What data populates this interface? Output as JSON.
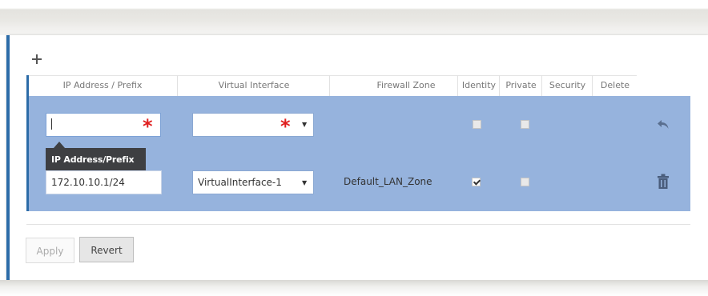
{
  "toolbar": {
    "add_icon": "plus-icon"
  },
  "table": {
    "columns": [
      "IP Address / Prefix",
      "Virtual Interface",
      "Firewall Zone",
      "Identity",
      "Private",
      "Security",
      "Delete"
    ],
    "new_row": {
      "ip_value": "",
      "virtual_interface_value": "",
      "identity_checked": false,
      "private_checked": false,
      "action_icon": "undo-icon"
    },
    "tooltip": "IP Address/Prefix",
    "rows": [
      {
        "ip": "172.10.10.1/24",
        "virtual_interface": "VirtualInterface-1",
        "firewall_zone": "Default_LAN_Zone",
        "identity_checked": true,
        "private_checked": false,
        "action_icon": "trash-icon"
      }
    ]
  },
  "required_marker": "*",
  "dropdown_arrow": "▼",
  "buttons": {
    "apply": "Apply",
    "revert": "Revert"
  },
  "colors": {
    "accent": "#2c6ca8",
    "row_highlight": "#96b3dd",
    "required": "#e02020",
    "tooltip_bg": "#3e3f42"
  }
}
